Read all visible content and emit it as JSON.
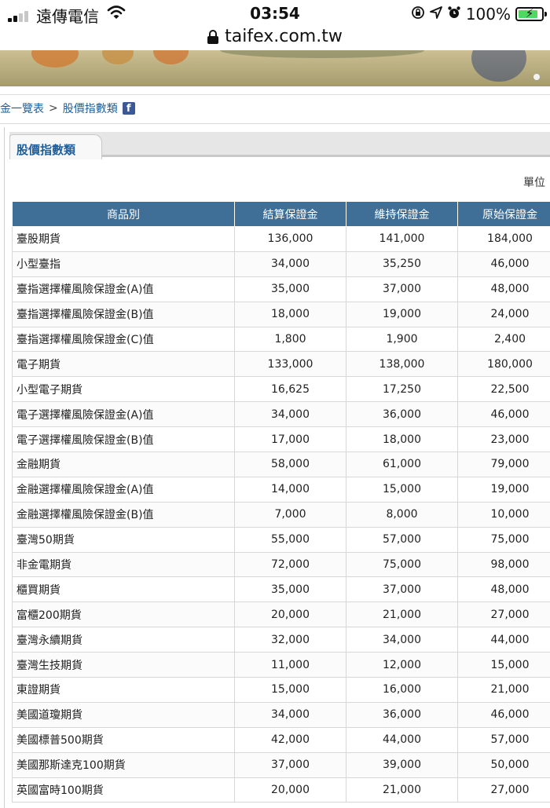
{
  "status_bar": {
    "carrier": "遠傳電信",
    "time": "03:54",
    "battery_percent": "100%",
    "icons": [
      "signal-icon",
      "wifi-icon",
      "rotation-lock-icon",
      "location-arrow-icon",
      "alarm-icon",
      "battery-charging-icon"
    ]
  },
  "browser": {
    "url": "taifex.com.tw"
  },
  "breadcrumb": {
    "items": [
      "金一覽表",
      "股價指數類"
    ],
    "separator": ">",
    "share_icon": "f"
  },
  "section": {
    "tab_label": "股價指數類",
    "unit_label": "單位"
  },
  "table": {
    "headers": [
      "商品別",
      "結算保證金",
      "維持保證金",
      "原始保證金"
    ],
    "rows": [
      [
        "臺股期貨",
        "136,000",
        "141,000",
        "184,000"
      ],
      [
        "小型臺指",
        "34,000",
        "35,250",
        "46,000"
      ],
      [
        "臺指選擇權風險保證金(A)值",
        "35,000",
        "37,000",
        "48,000"
      ],
      [
        "臺指選擇權風險保證金(B)值",
        "18,000",
        "19,000",
        "24,000"
      ],
      [
        "臺指選擇權風險保證金(C)值",
        "1,800",
        "1,900",
        "2,400"
      ],
      [
        "電子期貨",
        "133,000",
        "138,000",
        "180,000"
      ],
      [
        "小型電子期貨",
        "16,625",
        "17,250",
        "22,500"
      ],
      [
        "電子選擇權風險保證金(A)值",
        "34,000",
        "36,000",
        "46,000"
      ],
      [
        "電子選擇權風險保證金(B)值",
        "17,000",
        "18,000",
        "23,000"
      ],
      [
        "金融期貨",
        "58,000",
        "61,000",
        "79,000"
      ],
      [
        "金融選擇權風險保證金(A)值",
        "14,000",
        "15,000",
        "19,000"
      ],
      [
        "金融選擇權風險保證金(B)值",
        "7,000",
        "8,000",
        "10,000"
      ],
      [
        "臺灣50期貨",
        "55,000",
        "57,000",
        "75,000"
      ],
      [
        "非金電期貨",
        "72,000",
        "75,000",
        "98,000"
      ],
      [
        "櫃買期貨",
        "35,000",
        "37,000",
        "48,000"
      ],
      [
        "富櫃200期貨",
        "20,000",
        "21,000",
        "27,000"
      ],
      [
        "臺灣永續期貨",
        "32,000",
        "34,000",
        "44,000"
      ],
      [
        "臺灣生技期貨",
        "11,000",
        "12,000",
        "15,000"
      ],
      [
        "東證期貨",
        "15,000",
        "16,000",
        "21,000"
      ],
      [
        "美國道瓊期貨",
        "34,000",
        "36,000",
        "46,000"
      ],
      [
        "美國標普500期貨",
        "42,000",
        "44,000",
        "57,000"
      ],
      [
        "美國那斯達克100期貨",
        "37,000",
        "39,000",
        "50,000"
      ],
      [
        "英國富時100期貨",
        "20,000",
        "21,000",
        "27,000"
      ]
    ]
  },
  "colors": {
    "header_bg": "#3f6f97",
    "link": "#1f5e99",
    "battery_fill": "#4cd964"
  }
}
